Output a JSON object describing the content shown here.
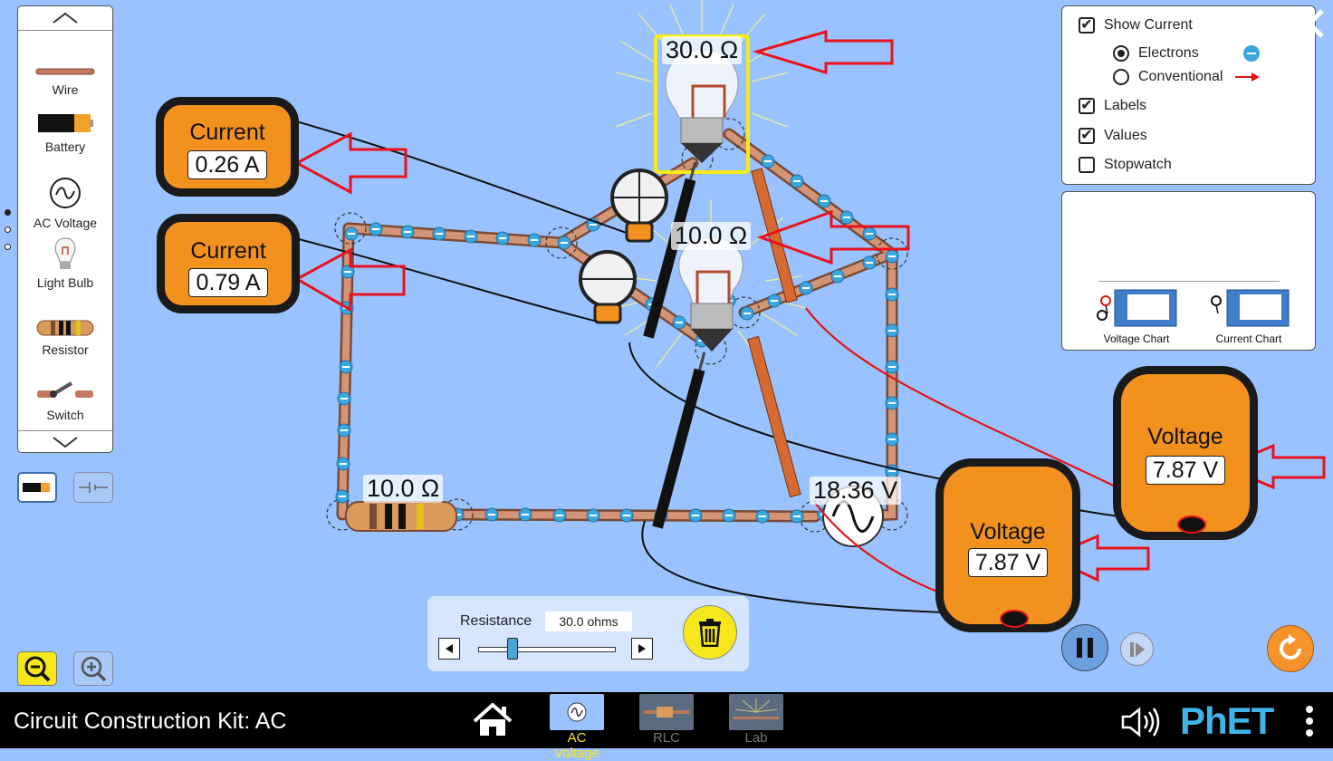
{
  "toolbox": {
    "items": [
      {
        "label": "Wire",
        "icon": "wire-icon"
      },
      {
        "label": "Battery",
        "icon": "battery-icon"
      },
      {
        "label": "AC Voltage",
        "icon": "ac-voltage-icon"
      },
      {
        "label": "Light Bulb",
        "icon": "light-bulb-icon"
      },
      {
        "label": "Resistor",
        "icon": "resistor-icon"
      },
      {
        "label": "Switch",
        "icon": "switch-icon"
      }
    ]
  },
  "options_panel": {
    "show_current": "Show Current",
    "electrons": "Electrons",
    "conventional": "Conventional",
    "labels": "Labels",
    "values": "Values",
    "stopwatch": "Stopwatch",
    "show_current_checked": true,
    "electrons_selected": true,
    "labels_checked": true,
    "values_checked": true,
    "stopwatch_checked": false
  },
  "charts_panel": {
    "voltage_chart": "Voltage Chart",
    "current_chart": "Current Chart"
  },
  "circuit": {
    "bulb_top_value": "30.0 Ω",
    "bulb_mid_value": "10.0 Ω",
    "resistor_value": "10.0 Ω",
    "ac_source_value": "18.36 V"
  },
  "meters": {
    "ammeter1": {
      "title": "Current",
      "reading": "0.26 A"
    },
    "ammeter2": {
      "title": "Current",
      "reading": "0.79 A"
    },
    "voltmeter1": {
      "title": "Voltage",
      "reading": "7.87 V"
    },
    "voltmeter2": {
      "title": "Voltage",
      "reading": "7.87 V"
    }
  },
  "resistance_control": {
    "label": "Resistance",
    "value": "30.0 ohms",
    "slider_fraction": 0.25
  },
  "navbar": {
    "title": "Circuit Construction Kit: AC",
    "screens": [
      {
        "label": "AC Voltage",
        "active": true
      },
      {
        "label": "RLC",
        "active": false
      },
      {
        "label": "Lab",
        "active": false
      }
    ],
    "brand": "PhET"
  },
  "colors": {
    "background": "#99c2ff",
    "meter_orange": "#f2911d",
    "wire_copper": "#c27a5a",
    "electron_blue": "#3aa7e0",
    "annotation_red": "#e8121e",
    "selection_yellow": "#f5ec18",
    "active_tab": "#f5e71c"
  }
}
